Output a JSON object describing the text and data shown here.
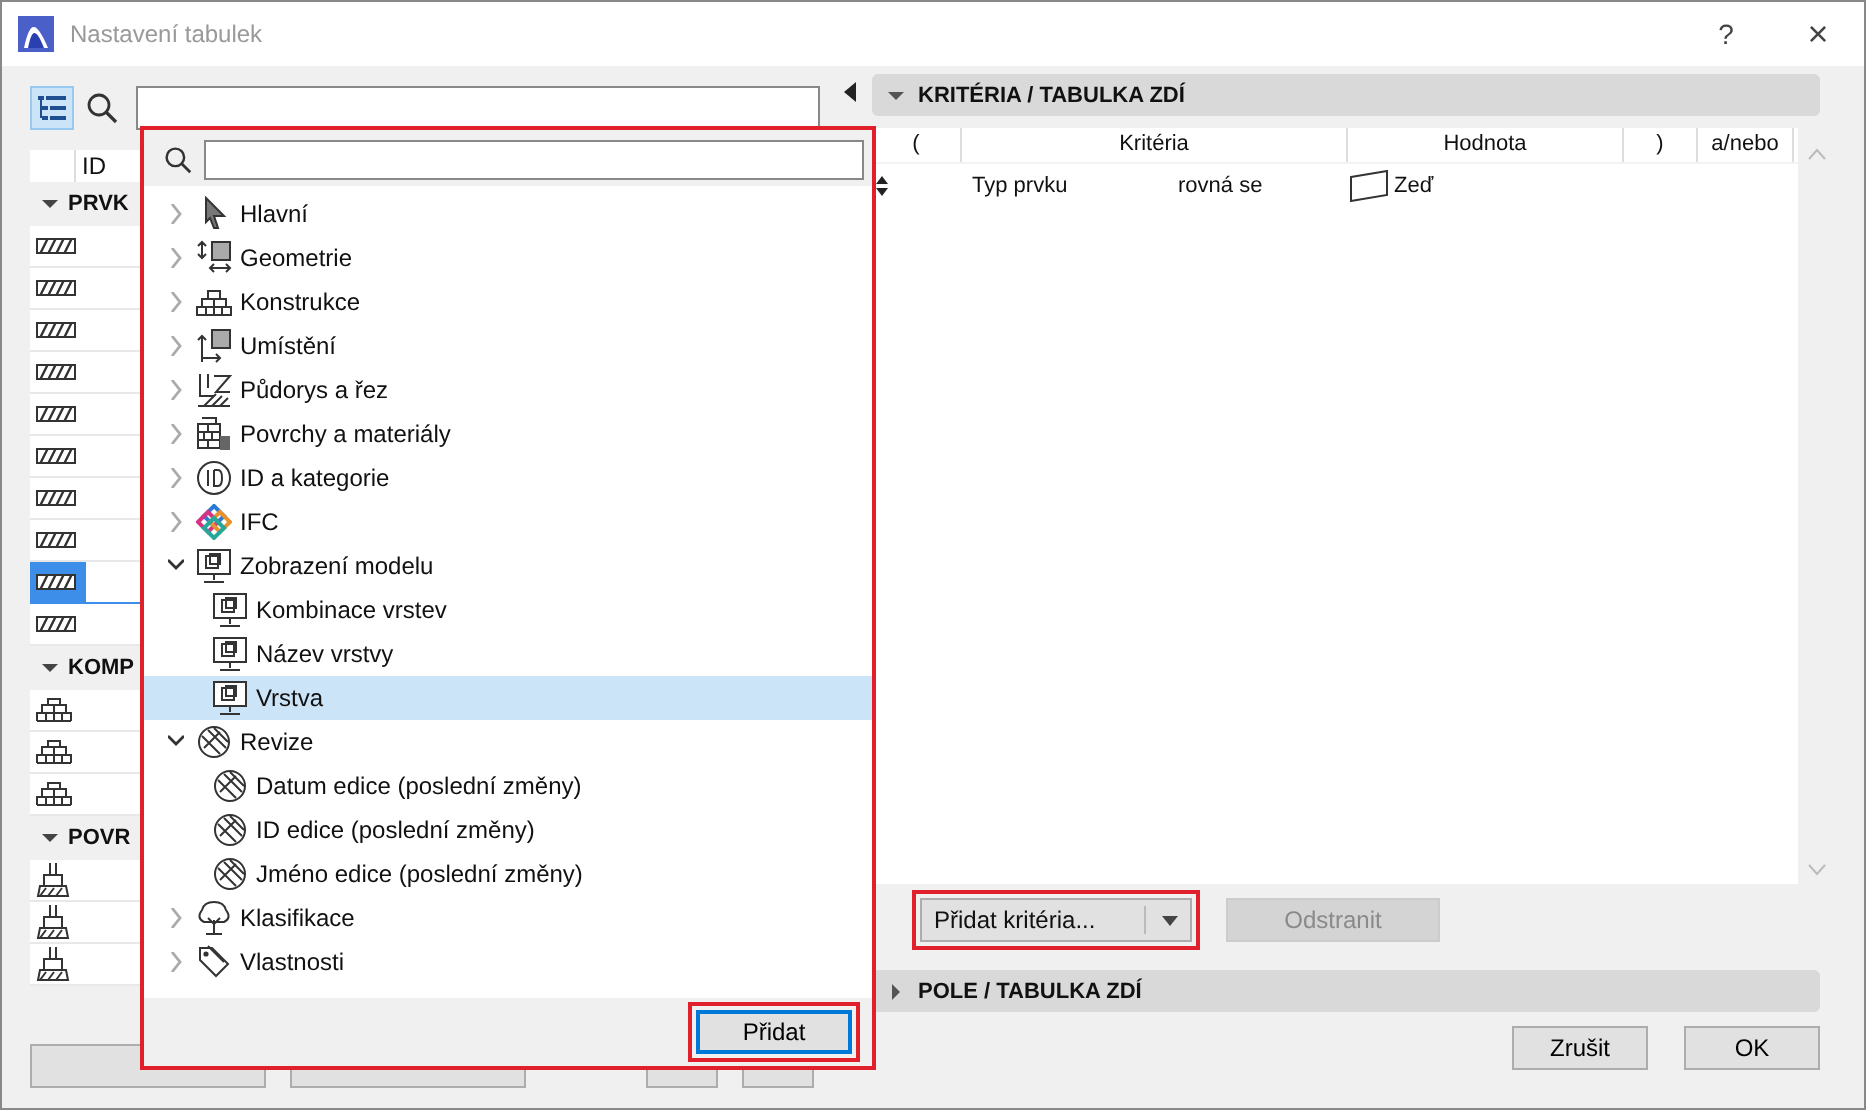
{
  "window": {
    "title": "Nastavení tabulek",
    "help": "?",
    "close": "×"
  },
  "left_panel": {
    "columns": [
      "ID"
    ],
    "sections": [
      {
        "title": "PRVK",
        "expanded": true,
        "kind": "hatch",
        "rows": [
          {
            "selected": false
          },
          {
            "selected": false
          },
          {
            "selected": false
          },
          {
            "selected": false
          },
          {
            "selected": false
          },
          {
            "selected": false
          },
          {
            "selected": false
          },
          {
            "selected": false
          },
          {
            "selected": true
          },
          {
            "selected": false
          }
        ]
      },
      {
        "title": "KOMP",
        "expanded": true,
        "kind": "brick",
        "rows": [
          {
            "selected": false
          },
          {
            "selected": false
          },
          {
            "selected": false
          }
        ]
      },
      {
        "title": "POVR",
        "expanded": true,
        "kind": "brush",
        "rows": [
          {
            "selected": false
          },
          {
            "selected": false
          },
          {
            "selected": false
          }
        ]
      }
    ]
  },
  "popup": {
    "highlighted": true,
    "items": [
      {
        "label": "Hlavní",
        "kind": "cursor",
        "expanded": false
      },
      {
        "label": "Geometrie",
        "kind": "geometry",
        "expanded": false
      },
      {
        "label": "Konstrukce",
        "kind": "brick",
        "expanded": false
      },
      {
        "label": "Umístění",
        "kind": "placement",
        "expanded": false
      },
      {
        "label": "Půdorys a řez",
        "kind": "plan",
        "expanded": false
      },
      {
        "label": "Povrchy a materiály",
        "kind": "surfaces",
        "expanded": false
      },
      {
        "label": "ID a kategorie",
        "kind": "id",
        "expanded": false
      },
      {
        "label": "IFC",
        "kind": "ifc",
        "expanded": false
      },
      {
        "label": "Zobrazení modelu",
        "kind": "monitor",
        "expanded": true,
        "children": [
          {
            "label": "Kombinace vrstev",
            "kind": "monitor",
            "selected": false
          },
          {
            "label": "Název vrstvy",
            "kind": "monitor",
            "selected": false
          },
          {
            "label": "Vrstva",
            "kind": "monitor",
            "selected": true
          }
        ]
      },
      {
        "label": "Revize",
        "kind": "revision",
        "expanded": true,
        "children": [
          {
            "label": "Datum edice (poslední změny)",
            "kind": "revision",
            "selected": false
          },
          {
            "label": "ID edice (poslední změny)",
            "kind": "revision",
            "selected": false
          },
          {
            "label": "Jméno edice (poslední změny)",
            "kind": "revision",
            "selected": false
          }
        ]
      },
      {
        "label": "Klasifikace",
        "kind": "tree",
        "expanded": false
      },
      {
        "label": "Vlastnosti",
        "kind": "tag",
        "expanded": false
      }
    ],
    "button": {
      "label": "Přidat",
      "highlighted": true
    }
  },
  "criteria_section": {
    "title": "KRITÉRIA /  TABULKA ZDÍ",
    "expanded": true,
    "columns": [
      "(",
      "Kritéria",
      "Hodnota",
      ")",
      "a/nebo"
    ],
    "rows": [
      {
        "criterion": "Typ prvku",
        "operator": "rovná se",
        "value": "Zeď"
      }
    ],
    "add_button": {
      "label": "Přidat kritéria...",
      "highlighted": true
    },
    "remove_button": {
      "label": "Odstranit",
      "disabled": true
    }
  },
  "fields_section": {
    "title": "POLE /  TABULKA ZDÍ",
    "expanded": false
  },
  "buttons": [
    "Zrušit",
    "OK"
  ]
}
